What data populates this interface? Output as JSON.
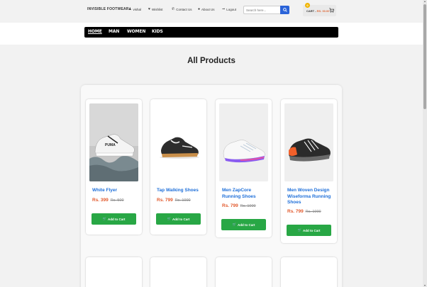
{
  "header": {
    "brand": "INVISIBLE FOOTWEAR",
    "links": [
      {
        "label": "vishal",
        "icon": "user-icon"
      },
      {
        "label": "Wishlist",
        "icon": "heart-icon"
      },
      {
        "label": "Contact Us",
        "icon": "phone-icon"
      },
      {
        "label": "About Us",
        "icon": "info-icon"
      },
      {
        "label": "Logout",
        "icon": "logout-icon"
      }
    ],
    "search": {
      "placeholder": "Search here..."
    },
    "cart": {
      "label": "CART - ",
      "amount": "RS. 00.00",
      "badge": "0"
    }
  },
  "categories": [
    "HOME",
    "MAN",
    "WOMEN",
    "KIDS"
  ],
  "page_title": "All Products",
  "products": [
    {
      "name": "White Flyer",
      "price": "Rs. 399",
      "old_price": "Rs. 500",
      "button": "Add to Cart"
    },
    {
      "name": "Tap Walking Shoes",
      "price": "Rs. 799",
      "old_price": "Rs. 1000",
      "button": "Add to Cart"
    },
    {
      "name": "Men ZapCore Running Shoes",
      "price": "Rs. 799",
      "old_price": "Rs. 1000",
      "button": "Add to Cart"
    },
    {
      "name": "Men Woven Design Wiseforma Running Shoes",
      "price": "Rs. 799",
      "old_price": "Rs. 1000",
      "button": "Add to Cart"
    }
  ],
  "colors": {
    "accent": "#2a63d8",
    "add_to_cart": "#28a745",
    "price": "#e25a2d",
    "product_link": "#1e6fd9",
    "navbar": "#000000"
  }
}
